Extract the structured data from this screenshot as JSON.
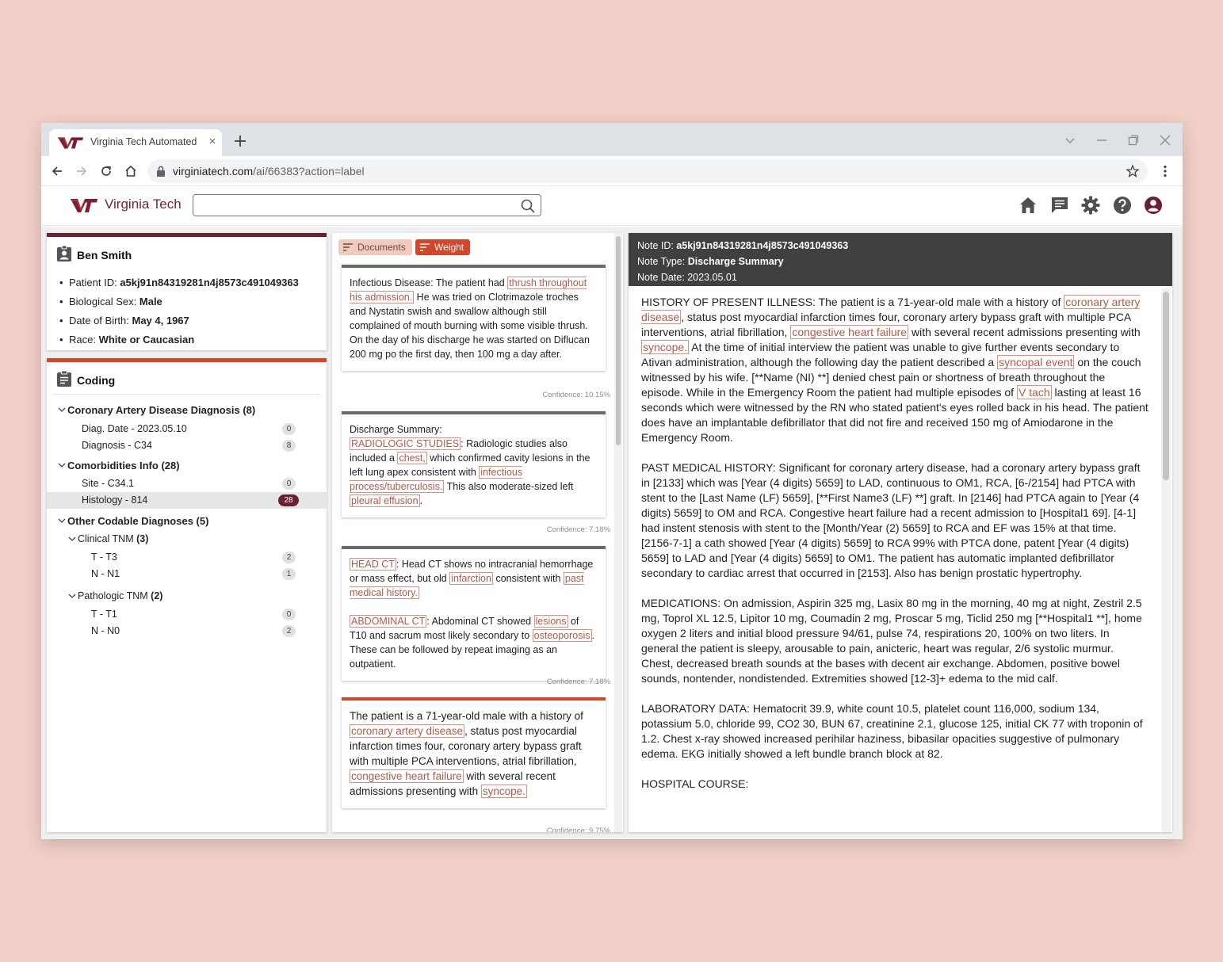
{
  "browser": {
    "tab_title": "Virginia Tech Automated",
    "tab_close": "×",
    "url_host": "virginiatech.com",
    "url_path": "/ai/66383?action=label"
  },
  "app": {
    "brand": "Virginia Tech",
    "brand_logo": "VT",
    "search_placeholder": "",
    "header_icons": [
      "home-icon",
      "chat-icon",
      "gear-icon",
      "help-icon",
      "account-icon"
    ]
  },
  "patient": {
    "name": "Ben Smith",
    "fields": [
      {
        "label": "Patient ID: ",
        "value": "a5kj91n84319281n4j8573c491049363"
      },
      {
        "label": "Biological Sex: ",
        "value": "Male"
      },
      {
        "label": "Date of Birth: ",
        "value": "May 4, 1967"
      },
      {
        "label": "Race: ",
        "value": "White or Caucasian"
      }
    ]
  },
  "coding": {
    "title": "Coding",
    "rows": [
      {
        "label": "Coronary Artery Disease Diagnosis ",
        "count": "(8)",
        "group": true,
        "level": 0
      },
      {
        "label": "Diag. Date - 2023.05.10",
        "badge": "0",
        "level": 1
      },
      {
        "label": "Diagnosis - C34",
        "badge": "8",
        "level": 1
      },
      {
        "label": "Comorbidities Info ",
        "count": "(28)",
        "group": true,
        "level": 0
      },
      {
        "label": "Site - C34.1",
        "badge": "0",
        "level": 1
      },
      {
        "label": "Histology - 814",
        "badge": "28",
        "level": 1,
        "selected": true
      },
      {
        "label": "Other Codable Diagnoses ",
        "count": "(5)",
        "group": true,
        "level": 0
      },
      {
        "label": "Clinical TNM ",
        "count": "(3)",
        "subgroup": true,
        "level": 1
      },
      {
        "label": "T - T3",
        "badge": "2",
        "level": 2
      },
      {
        "label": "N - N1",
        "badge": "1",
        "level": 2
      },
      {
        "label": "Pathologic TNM ",
        "count": "(2)",
        "subgroup": true,
        "level": 1
      },
      {
        "label": "T - T1",
        "badge": "0",
        "level": 2
      },
      {
        "label": "N - N0",
        "badge": "2",
        "level": 2
      }
    ]
  },
  "documents": {
    "tab_documents": "Documents",
    "tab_weight": "Weight",
    "snippets": [
      {
        "style": "gray",
        "paragraphs": [
          [
            {
              "t": "Infectious Disease: The patient had "
            },
            {
              "t": "thrush throughout his admission.",
              "hl": true
            },
            {
              "t": " He was tried on Clotrimazole troches and Nystatin swish and swallow although still complained of mouth burning with some visible thrush. On the day of his discharge he was started on Diflucan 200 mg po the first day, then 100 mg a day after."
            }
          ]
        ],
        "confidence": "Confidence: 10.15%"
      },
      {
        "style": "gray",
        "paragraphs": [
          [
            {
              "t": "Discharge Summary:"
            }
          ],
          [
            {
              "t": "RADIOLOGIC STUDIES",
              "hl": true
            },
            {
              "t": ": Radiologic studies also included a "
            },
            {
              "t": "chest,",
              "hl": true
            },
            {
              "t": " which confirmed cavity lesions in the left lung apex consistent with "
            },
            {
              "t": "infectious process/tuberculosis.",
              "hl": true
            },
            {
              "t": " This also moderate-sized left "
            },
            {
              "t": "pleural effusion",
              "hl": true
            },
            {
              "t": "."
            }
          ]
        ],
        "confidence": "Confidence: 7.18%"
      },
      {
        "style": "gray",
        "paragraphs": [
          [
            {
              "t": "HEAD CT",
              "hl": true
            },
            {
              "t": ": Head CT shows no intracranial hemorrhage or mass effect, but old "
            },
            {
              "t": "infarction",
              "hl": true
            },
            {
              "t": " consistent with "
            },
            {
              "t": "past medical history.",
              "hl": true
            }
          ],
          [
            {
              "t": "ABDOMINAL CT",
              "hl": true
            },
            {
              "t": ": Abdominal CT showed "
            },
            {
              "t": "lesions",
              "hl": true
            },
            {
              "t": " of T10 and sacrum most likely secondary to "
            },
            {
              "t": "osteoporosis",
              "hl": true
            },
            {
              "t": ". These can be followed by repeat imaging as an outpatient."
            }
          ]
        ],
        "confidence": "Confidence: 7.18%"
      },
      {
        "style": "red",
        "paragraphs": [
          [
            {
              "t": "The patient is a 71-year-old male with a history of "
            },
            {
              "t": "coronary artery disease",
              "hl": true
            },
            {
              "t": ", status post myocardial infarction times four, coronary artery bypass graft with multiple PCA interventions, atrial fibrillation, "
            },
            {
              "t": "congestive heart failure",
              "hl": true
            },
            {
              "t": " with several recent admissions presenting with "
            },
            {
              "t": "syncope.",
              "hl": true
            }
          ]
        ],
        "confidence": "Confidence: 9.75%"
      }
    ]
  },
  "note": {
    "id_label": "Note ID: ",
    "id": "a5kj91n84319281n4j8573c491049363",
    "type_label": "Note Type: ",
    "type": "Discharge Summary",
    "date_label": "Note Date: ",
    "date": "2023.05.01",
    "paragraphs": [
      [
        {
          "t": "HISTORY OF PRESENT ILLNESS: The patient is a 71-year-old male with a history of "
        },
        {
          "t": "coronary artery disease",
          "hl": true
        },
        {
          "t": ", status post myocardial infarction times four, coronary artery bypass graft with multiple PCA interventions, atrial fibrillation, "
        },
        {
          "t": "congestive heart failure",
          "hl": true
        },
        {
          "t": " with several recent admissions presenting with "
        },
        {
          "t": "syncope.",
          "hl": true
        },
        {
          "t": " At the time of initial interview the patient was unable to give further events secondary to Ativan administration, although the following day the patient described a "
        },
        {
          "t": "syncopal event",
          "hl": true
        },
        {
          "t": " on the couch witnessed by his wife. [**Name (NI) **] denied chest pain or shortness of breath throughout the episode. While in the Emergency Room the patient had multiple episodes of "
        },
        {
          "t": "V tach",
          "hl": true
        },
        {
          "t": " lasting at least 16 seconds which were witnessed by the RN who stated patient's eyes rolled back in his head. The patient does have an implantable defibrillator that did not fire and received 150 mg of Amiodarone in the Emergency Room."
        }
      ],
      [
        {
          "t": "PAST MEDICAL HISTORY: Significant for coronary artery disease, had a coronary artery bypass graft in [2133] which was [Year (4 digits) 5659] to LAD, continuous to OM1, RCA, [6-/2154] had PTCA with stent to the [Last Name (LF) 5659], [**First Name3 (LF) **] graft. In [2146] had PTCA again to [Year (4 digits) 5659] to OM and RCA. Congestive heart failure had a recent admission to [Hospital1 69]. [4-1] had instent stenosis with stent to the [Month/Year (2) 5659] to RCA and EF was 15% at that time. [2156-7-1] a cath showed [Year (4 digits) 5659] to RCA 99% with PTCA done, patent [Year (4 digits) 5659] to LAD and [Year (4 digits) 5659] to OM1. The patient has automatic implanted defibrillator secondary to cardiac arrest that occurred in [2153]. Also has benign prostatic hypertrophy."
        }
      ],
      [
        {
          "t": "MEDICATIONS: On admission, Aspirin 325 mg, Lasix 80 mg in the morning, 40 mg at night, Zestril 2.5 mg, Toprol XL 12.5, Lipitor 10 mg, Coumadin 2 mg, Proscar 5 mg, Ticlid 250 mg [**Hospital1 **], home oxygen 2 liters and initial blood pressure 94/61, pulse 74, respirations 20, 100% on two liters. In general the patient is sleepy, arousable to pain, anicteric, heart was regular, 2/6 systolic murmur. Chest, decreased breath sounds at the bases with decent air exchange. Abdomen, positive bowel sounds, nontender, nondistended. Extremities showed [12-3]+ edema to the mid calf."
        }
      ],
      [
        {
          "t": "LABORATORY DATA: Hematocrit 39.9, white count 10.5, platelet count 116,000, sodium 134, potassium 5.0, chloride 99, CO2 30, BUN 67, creatinine 2.1, glucose 125, initial CK 77 with troponin of 1.2. Chest x-ray showed increased perihilar haziness, bibasilar opacities suggestive of pulmonary edema. EKG initially showed a left bundle branch block at 82."
        }
      ],
      [
        {
          "t": "HOSPITAL COURSE:"
        }
      ]
    ]
  },
  "colors": {
    "maroon": "#6b1f33",
    "orange": "#d2462a",
    "highlight_border": "#e08f80",
    "background": "#f2d0c8"
  }
}
